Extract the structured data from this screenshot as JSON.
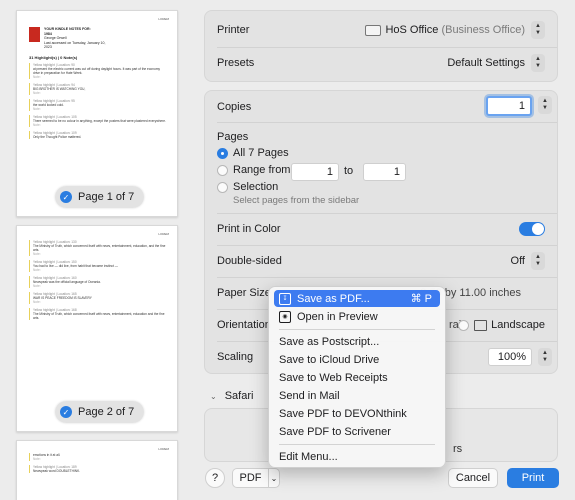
{
  "sidebar": {
    "pages": [
      {
        "badge": "Page 1 of 7"
      },
      {
        "badge": "Page 2 of 7"
      },
      {
        "badge": ""
      }
    ],
    "page1_text": {
      "book_title": "YOUR KINDLE NOTES FOR:",
      "book_name": "1984",
      "author": "George Orwell",
      "last": "Last accessed on Tuesday, January 10,",
      "year": "2023",
      "count": "31 Highlight(s) | 0 Note(s)",
      "h1": "Yellow highlight | Location: 90",
      "q1": "at present the electric current was cut off during daylight hours. It was part of the economy drive in preparation for Hate Week.",
      "h2": "Yellow highlight | Location: 94",
      "q2": "BIG BROTHER IS WATCHING YOU,",
      "h3": "Yellow highlight | Location: 95",
      "q3": "the world looked cold.",
      "h4": "Yellow highlight | Location: 105",
      "q4": "There seemed to be no colour in anything, except the posters that were plastered everywhere.",
      "h5": "Yellow highlight | Location: 109",
      "q5": "Only the Thought Police mattered."
    },
    "page2_text": {
      "q1": "The Ministry of Truth, which concerned itself with news, entertainment, education, and the fine arts.",
      "q2": "You had to live — did live, from habit that became instinct —",
      "q3": "Newspeak was the official language of Oceania.",
      "q4": "WAR IS PEACE FREEDOM IS SLAVERY",
      "q5": "The Ministry of Truth, which concerned itself with news, entertainment, education and the fine arts."
    },
    "page3_text": {
      "q1": "emotions in it at all.",
      "h1": "Yellow highlight | Location: 189",
      "q2": "Newspeak word DOUBLETHINK."
    }
  },
  "settings": {
    "printer_label": "Printer",
    "printer_value": "HoS Office",
    "printer_sub": "(Business Office)",
    "presets_label": "Presets",
    "presets_value": "Default Settings",
    "copies_label": "Copies",
    "copies_value": "1",
    "pages_label": "Pages",
    "all_pages": "All 7 Pages",
    "range_from": "Range from",
    "range_from_value": "1",
    "range_to": "to",
    "range_to_value": "1",
    "selection": "Selection",
    "selection_hint": "Select pages from the sidebar",
    "color_label": "Print in Color",
    "double_label": "Double-sided",
    "double_value": "Off",
    "paper_label": "Paper Size",
    "paper_value": "8.50 by 11.00 inches",
    "orientation_label": "Orientation",
    "orientation_portrait": "rait",
    "orientation_landscape": "Landscape",
    "scaling_label": "Scaling",
    "scaling_value": "100%",
    "safari_label": "Safari",
    "hidden_text": "rs"
  },
  "footer": {
    "help": "?",
    "pdf": "PDF",
    "cancel": "Cancel",
    "print": "Print"
  },
  "menu": {
    "items": [
      {
        "label": "Save as PDF...",
        "shortcut": "⌘ P"
      },
      {
        "label": "Open in Preview"
      },
      {
        "label": "Save as Postscript..."
      },
      {
        "label": "Save to iCloud Drive"
      },
      {
        "label": "Save to Web Receipts"
      },
      {
        "label": "Send in Mail"
      },
      {
        "label": "Save PDF to DEVONthink"
      },
      {
        "label": "Save PDF to Scrivener"
      },
      {
        "label": "Edit Menu..."
      }
    ]
  },
  "colors": {
    "accent": "#2a7de1",
    "menu_selected": "#3d7bf0"
  }
}
